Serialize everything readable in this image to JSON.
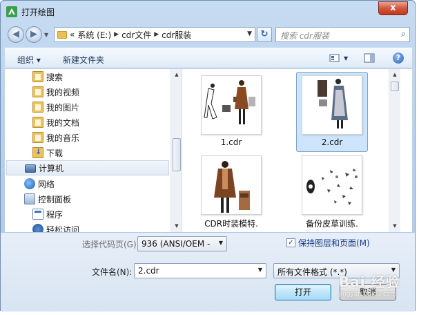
{
  "window": {
    "title": "打开绘图",
    "close_label": "x"
  },
  "nav": {
    "back_label": "◀",
    "forward_label": "▶",
    "breadcrumb": [
      "«",
      "系统 (E:)",
      "cdr文件",
      "cdr服装"
    ],
    "search_placeholder": "搜索 cdr服装"
  },
  "toolbar": {
    "organize_label": "组织 ▾",
    "new_folder_label": "新建文件夹"
  },
  "nav_pane": {
    "items": [
      {
        "label": "搜索",
        "icon": "library-folder-icon"
      },
      {
        "label": "我的视频",
        "icon": "library-folder-icon"
      },
      {
        "label": "我的图片",
        "icon": "library-folder-icon"
      },
      {
        "label": "我的文档",
        "icon": "library-folder-icon"
      },
      {
        "label": "我的音乐",
        "icon": "library-folder-icon"
      },
      {
        "label": "下载",
        "icon": "download-folder-icon"
      },
      {
        "label": "计算机",
        "icon": "computer-icon",
        "selected": true
      },
      {
        "label": "网络",
        "icon": "network-icon"
      },
      {
        "label": "控制面板",
        "icon": "control-panel-icon"
      },
      {
        "label": "程序",
        "icon": "programs-icon"
      },
      {
        "label": "轻松访问",
        "icon": "ease-of-access-icon"
      }
    ]
  },
  "files": [
    {
      "name": "1.cdr",
      "selected": false
    },
    {
      "name": "2.cdr",
      "selected": true
    },
    {
      "name": "CDR时装模特.",
      "selected": false
    },
    {
      "name": "备份皮草训练.",
      "selected": false
    }
  ],
  "bottom": {
    "codepage_label": "选择代码页(G)",
    "codepage_value": "936   (ANSI/OEM -",
    "keep_layers_label": "保持图层和页面(M)",
    "keep_layers_checked": "✓",
    "filename_label": "文件名(N):",
    "filename_value": "2.cdr",
    "filetype_value": "所有文件格式 (*.*)",
    "open_label": "打开",
    "cancel_label": "取消"
  },
  "watermark": {
    "text": "Bai 经验",
    "sub": "jingyan.baidu.com"
  },
  "colors": {
    "accent": "#2a62b5",
    "selection": "#cde4fb",
    "close": "#c2371b"
  }
}
